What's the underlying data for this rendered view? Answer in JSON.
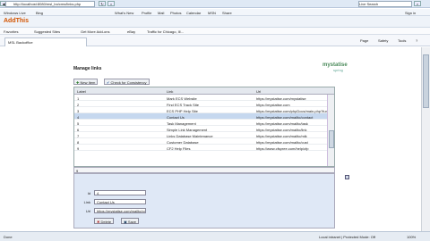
{
  "browser": {
    "address": "http://localhost:8080/msl_bo/cms/links.php",
    "search_engine": "Live Search",
    "tab_title": "MSL Backoffice",
    "menu": {
      "page": "Page",
      "safety": "Safety",
      "tools": "Tools",
      "help": "Help"
    },
    "toolbar_links": [
      "Windows Live",
      "Bing",
      "What's New",
      "Profile",
      "Mail",
      "Photos",
      "Calendar",
      "MSN",
      "Share"
    ],
    "sign_in": "Sign in",
    "addthis": "AddThis",
    "favorites": [
      "Favorites",
      "Suggested Sites",
      "Get More Add-ons",
      "eBay",
      "Traffic for Chicago, Ill..."
    ],
    "status": {
      "left": "Done",
      "zone": "Local intranet | Protected Mode: Off",
      "zoom": "100%"
    }
  },
  "page": {
    "title": "Manage links",
    "logo_main": "mystatise",
    "logo_sub": "spring",
    "toolbar": {
      "new_label": "New Item",
      "check_label": "Check for Consistency"
    },
    "grid": {
      "columns": [
        "Label",
        "Link",
        "Url"
      ],
      "rows": [
        {
          "id": "1",
          "link": "Mark ECS Website",
          "url": "https://mystatise.com/mystatise"
        },
        {
          "id": "2",
          "link": "Find ECS Track Site",
          "url": "https://mystatise.com"
        },
        {
          "id": "3",
          "link": "ECS PHP Help Site",
          "url": "https://mystatise.com/phpDocs/main.php?func"
        },
        {
          "id": "4",
          "link": "Contact Us",
          "url": "https://mystatise.com/mailto/contact"
        },
        {
          "id": "5",
          "link": "Task Management",
          "url": "https://mystatise.com/mailto/task"
        },
        {
          "id": "6",
          "link": "Simple Link Management",
          "url": "https://mystatise.com/mailto/link"
        },
        {
          "id": "7",
          "link": "Links Database Maintenance",
          "url": "https://mystatise.com/mailto/mlk"
        },
        {
          "id": "8",
          "link": "Customer Database",
          "url": "https://mystatise.com/mailto/cust"
        },
        {
          "id": "9",
          "link": "CF2 Help Files",
          "url": "https://www.cfspree.com/help/cfp"
        }
      ],
      "selected_index": 3,
      "pager_value": "9"
    },
    "form": {
      "id_label": "Id",
      "id_value": "4",
      "link_label": "Link",
      "link_value": "Contact Us",
      "url_label": "Url",
      "url_value": "https://mystatise.com/mailto/contact",
      "delete_label": "Delete",
      "save_label": "Save"
    }
  }
}
